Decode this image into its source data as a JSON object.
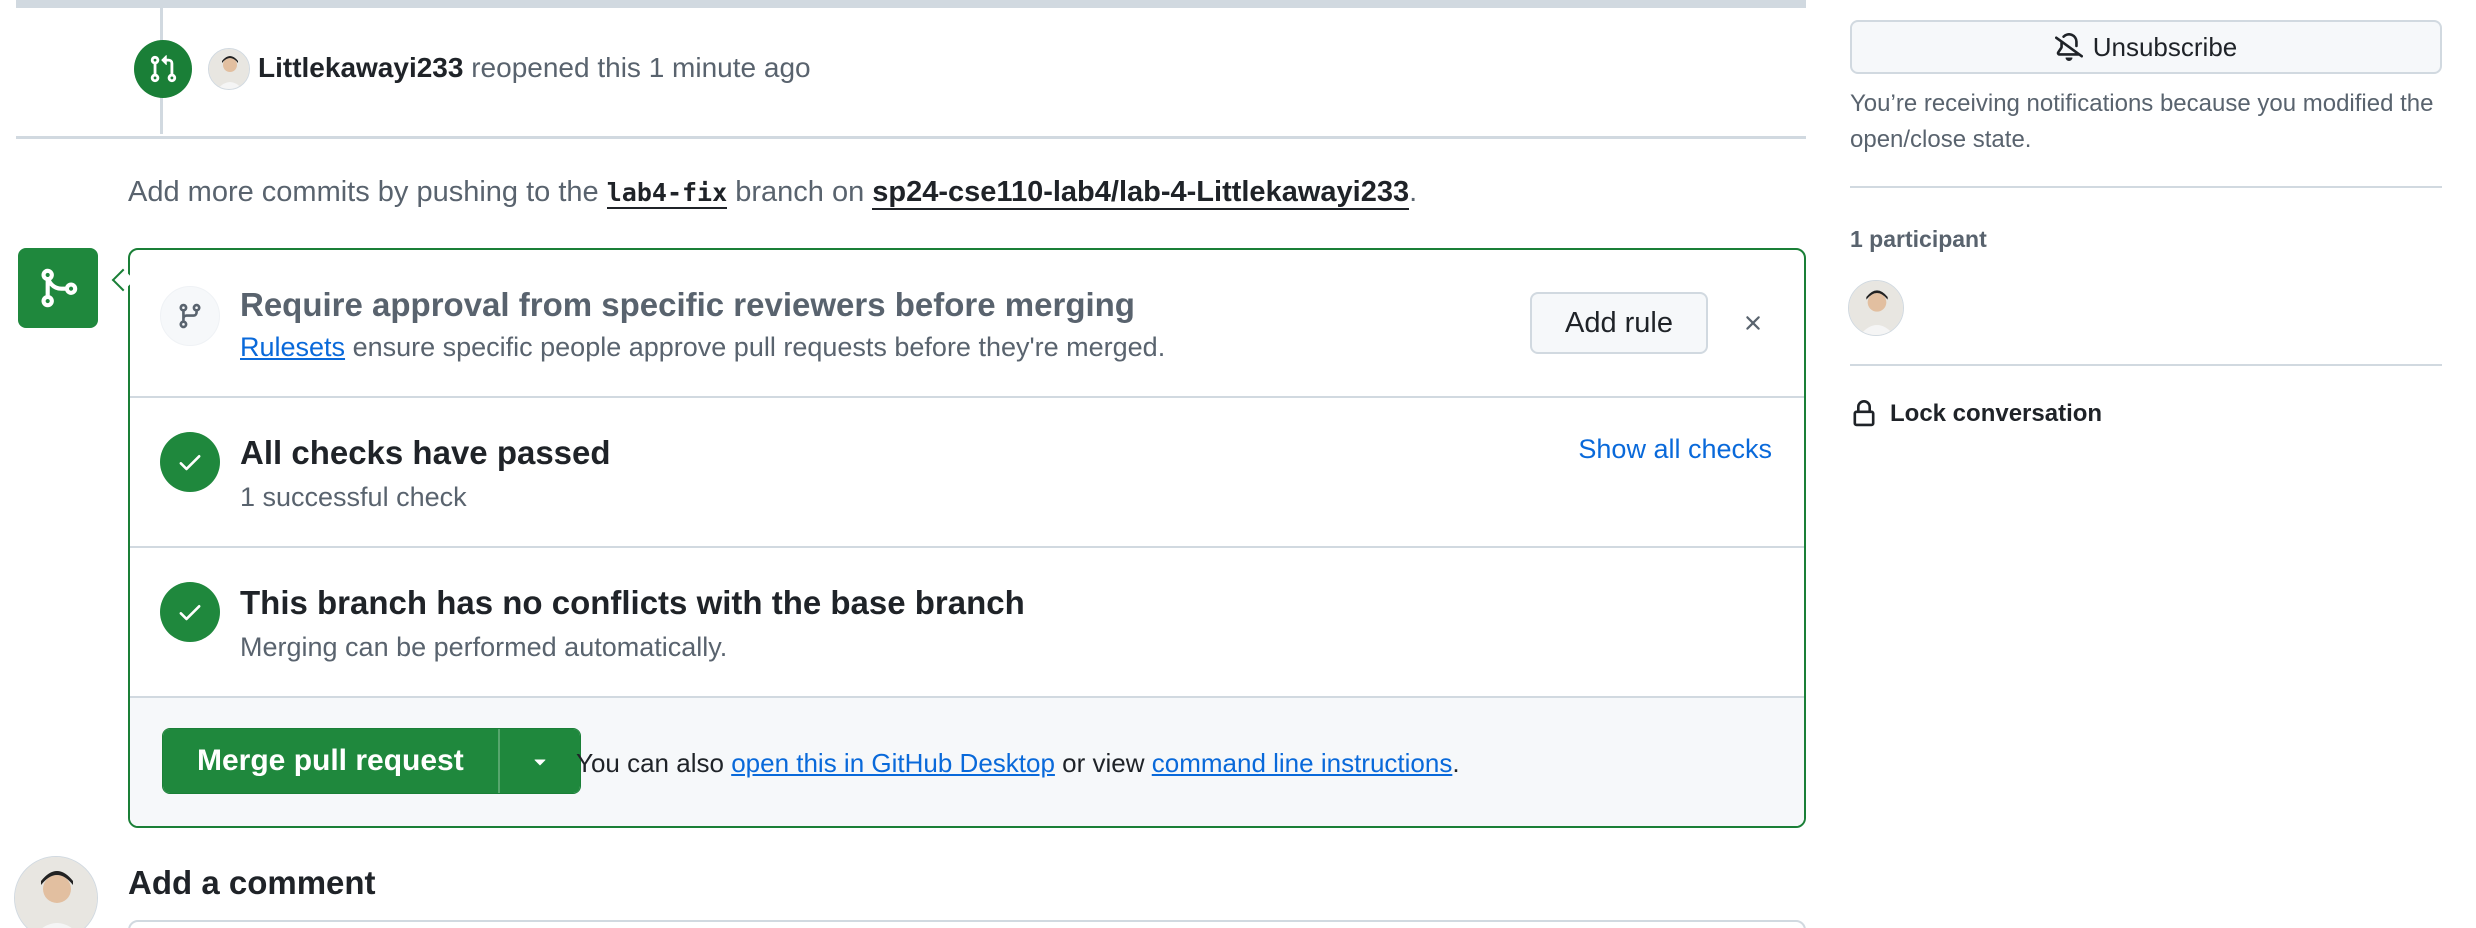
{
  "timeline": {
    "event": {
      "user": "Littlekawayi233",
      "action": "reopened this",
      "time": "1 minute ago"
    }
  },
  "push_hint": {
    "prefix": "Add more commits by pushing to the",
    "branch": "lab4-fix",
    "middle": "branch on",
    "repo": "sp24-cse110-lab4/lab-4-Littlekawayi233",
    "suffix": "."
  },
  "merge_box": {
    "ruleset": {
      "title": "Require approval from specific reviewers before merging",
      "link": "Rulesets",
      "text": "ensure specific people approve pull requests before they're merged.",
      "add_rule_label": "Add rule",
      "close_icon": "x-icon"
    },
    "checks": {
      "title": "All checks have passed",
      "subtitle": "1 successful check",
      "show_all_label": "Show all checks"
    },
    "conflicts": {
      "title": "This branch has no conflicts with the base branch",
      "subtitle": "Merging can be performed automatically."
    },
    "merge": {
      "button_label": "Merge pull request",
      "note_prefix": "You can also",
      "desktop_link": "open this in GitHub Desktop",
      "note_middle": "or view",
      "cli_link": "command line instructions",
      "note_suffix": "."
    }
  },
  "comment": {
    "heading": "Add a comment"
  },
  "sidebar": {
    "unsubscribe_label": "Unsubscribe",
    "notification_reason": "You’re receiving notifications because you modified the open/close state.",
    "participants_label": "1 participant",
    "lock_label": "Lock conversation"
  },
  "colors": {
    "success": "#1f883d",
    "link": "#0969da",
    "border": "#d1d9e0",
    "muted_text": "#59636e"
  }
}
